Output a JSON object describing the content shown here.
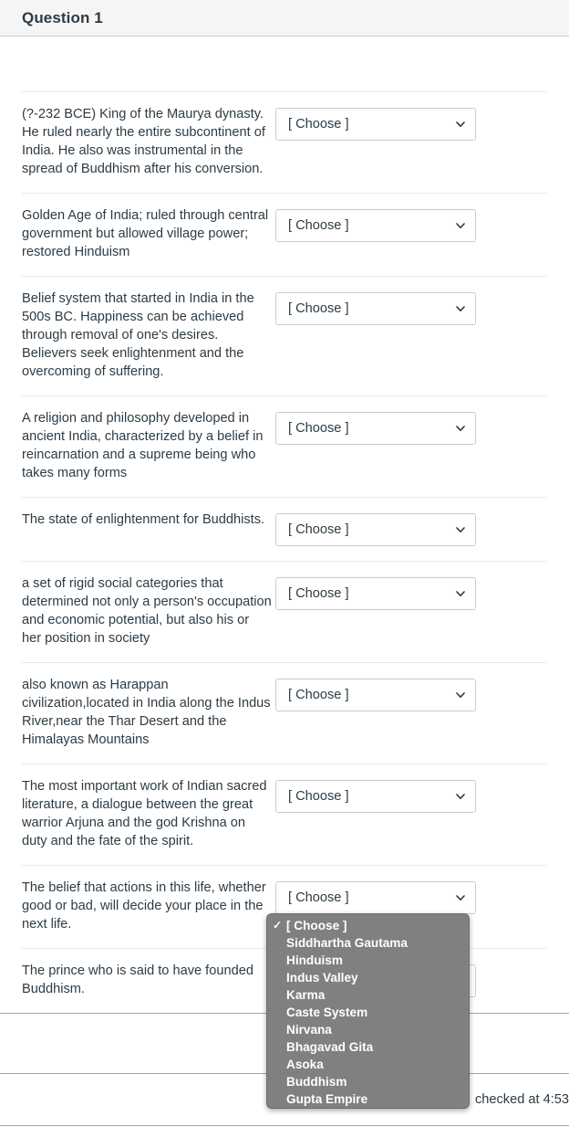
{
  "header": {
    "title": "Question 1"
  },
  "select": {
    "value": "[ Choose ]",
    "chevron_icon": "chevron-down-icon"
  },
  "rows": [
    {
      "prompt": "(?-232 BCE) King of the Maurya dynasty. He ruled nearly the entire subcontinent of India. He also was instrumental in the spread of Buddhism after his conversion.",
      "value": "[ Choose ]"
    },
    {
      "prompt": "Golden Age of India; ruled through central government but allowed village power; restored Hinduism",
      "value": "[ Choose ]"
    },
    {
      "prompt": "Belief system that started in India in the 500s BC. Happiness can be achieved through removal of one's desires. Believers seek enlightenment and the overcoming of suffering.",
      "value": "[ Choose ]"
    },
    {
      "prompt": "A religion and philosophy developed in ancient India, characterized by a belief in reincarnation and a supreme being who takes many forms",
      "value": "[ Choose ]"
    },
    {
      "prompt": "The state of enlightenment for Buddhists.",
      "value": "[ Choose ]"
    },
    {
      "prompt": "a set of rigid social categories that determined not only a person's occupation and economic potential, but also his or her position in society",
      "value": "[ Choose ]"
    },
    {
      "prompt": "also known as Harappan civilization,located in India along the Indus River,near the Thar Desert and the Himalayas Mountains",
      "value": "[ Choose ]"
    },
    {
      "prompt": "The most important work of Indian sacred literature, a dialogue between the great warrior Arjuna and the god Krishna on duty and the fate of the spirit.",
      "value": "[ Choose ]"
    },
    {
      "prompt": "The belief that actions in this life, whether good or bad, will decide your place in the next life.",
      "value": "[ Choose ]"
    },
    {
      "prompt": "The prince who is said to have founded Buddhism.",
      "value": "[ Choose ]"
    }
  ],
  "dropdown": {
    "open": true,
    "selected_index": 0,
    "check_glyph": "✓",
    "options": [
      "[ Choose ]",
      "Siddhartha Gautama",
      "Hinduism",
      "Indus Valley",
      "Karma",
      "Caste System",
      "Nirvana",
      "Bhagavad Gita",
      "Asoka",
      "Buddhism",
      "Gupta Empire"
    ]
  },
  "footer": {
    "status": "checked at 4:53"
  },
  "colors": {
    "header_bg": "#f5f5f5",
    "text": "#2d3b45",
    "border": "#c7cdd1",
    "divider": "#e8eaec",
    "popup_bg": "#808080",
    "popup_text": "#ffffff"
  }
}
